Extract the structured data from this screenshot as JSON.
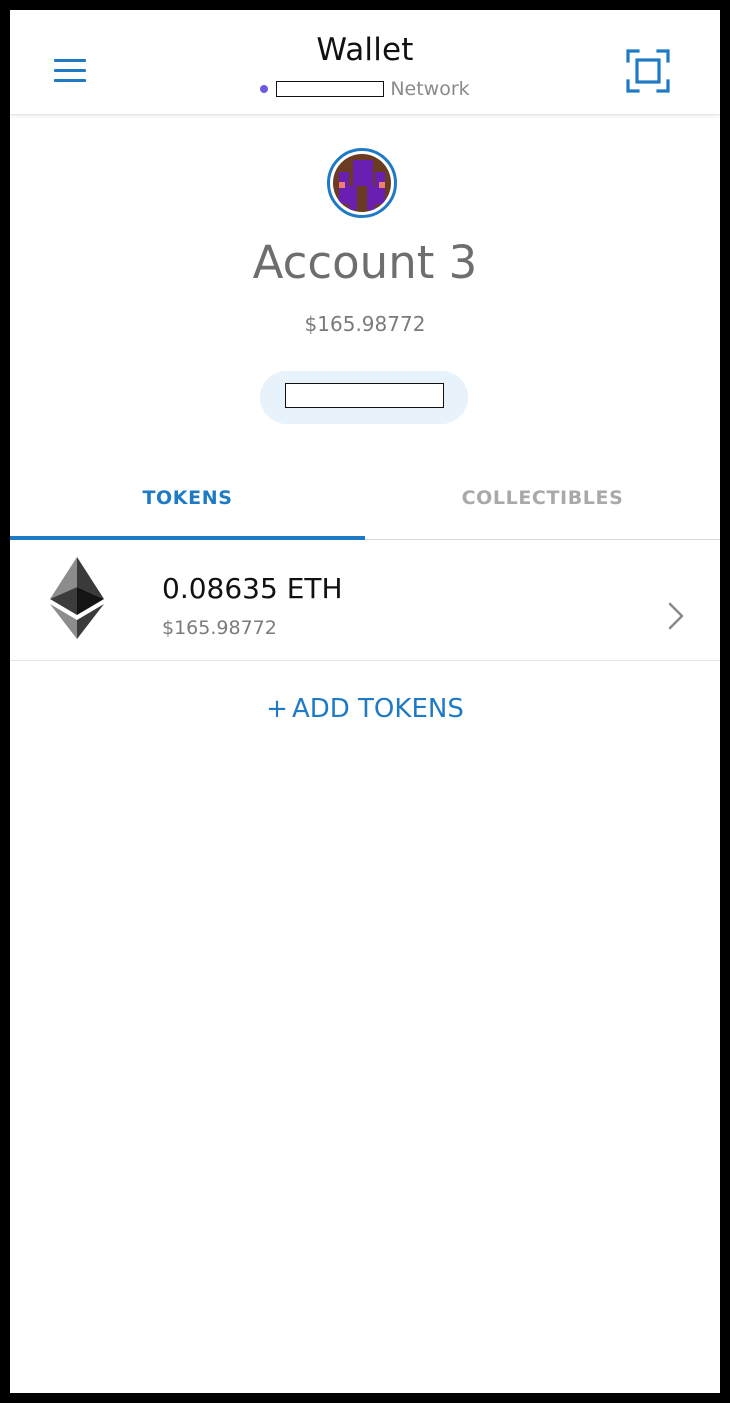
{
  "header": {
    "title": "Wallet",
    "network_label": "Network",
    "accent_color": "#1f7ac5",
    "network_dot_color": "#6a5be2"
  },
  "account": {
    "name": "Account 3",
    "balance": "$165.98772"
  },
  "tabs": [
    {
      "label": "TOKENS",
      "active": true
    },
    {
      "label": "COLLECTIBLES",
      "active": false
    }
  ],
  "tokens": [
    {
      "icon": "ethereum-icon",
      "amount": "0.08635 ETH",
      "fiat": "$165.98772"
    }
  ],
  "add_tokens": {
    "plus": "+",
    "label": "ADD TOKENS"
  }
}
